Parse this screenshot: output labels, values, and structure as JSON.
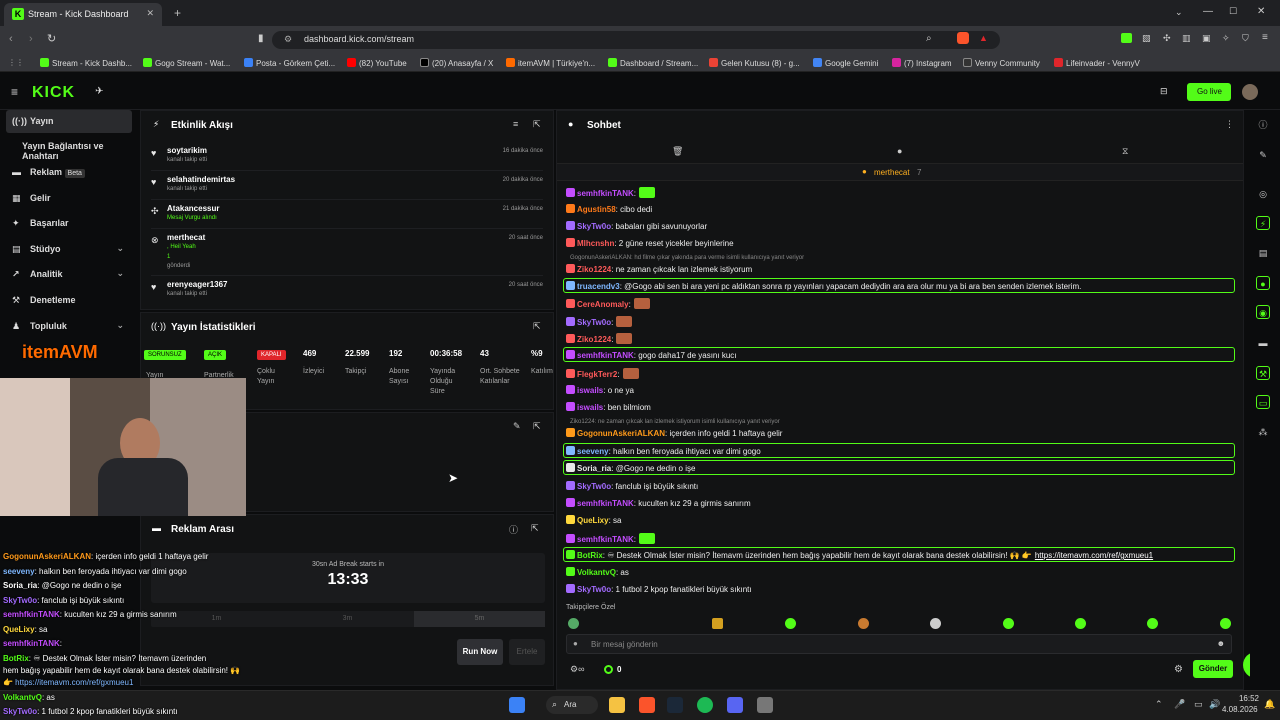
{
  "browser": {
    "tab_title": "Stream - Kick Dashboard",
    "url": "dashboard.kick.com/stream",
    "bookmarks": [
      "Stream - Kick Dashb...",
      "Gogo Stream - Wat...",
      "Posta - Görkem Çeti...",
      "(82) YouTube",
      "(20) Anasayfa / X",
      "itemAVM | Türkiye'n...",
      "Dashboard / Stream...",
      "Gelen Kutusu (8) - g...",
      "Google Gemini",
      "(7) Instagram",
      "Venny Community",
      "Lifeinvader - VennyV"
    ]
  },
  "nav": {
    "logo": "KICK",
    "go_live": "Go live"
  },
  "sidebar": {
    "items": [
      {
        "label": "Yayın"
      },
      {
        "label": "Yayın Bağlantısı ve Anahtarı"
      },
      {
        "label": "Reklam",
        "badge": "Beta"
      },
      {
        "label": "Gelir"
      },
      {
        "label": "Başarılar"
      },
      {
        "label": "Stüdyo"
      },
      {
        "label": "Analitik"
      },
      {
        "label": "Denetleme"
      },
      {
        "label": "Topluluk"
      }
    ]
  },
  "activity": {
    "title": "Etkinlik Akışı",
    "events": [
      {
        "name": "soytarikim",
        "sub": "kanalı takip etti",
        "time": "16 dakika önce"
      },
      {
        "name": "selahatindemirtas",
        "sub": "kanalı takip etti",
        "time": "20 dakika önce"
      },
      {
        "name": "Atakancessur",
        "sub": "Mesaj Vurgu alındı",
        "time": "21 dakika önce"
      },
      {
        "name": "merthecat",
        "sub": ", Heil Yeah",
        "sub2": "1",
        "sub3": "gönderdi",
        "time": "20 saat önce"
      },
      {
        "name": "erenyeager1367",
        "sub": "kanalı takip etti",
        "time": "20 saat önce"
      }
    ]
  },
  "stats": {
    "title": "Yayın İstatistikleri",
    "badges": [
      {
        "text": "SORUNSUZ",
        "color": "#53fc18"
      },
      {
        "text": "AÇIK",
        "color": "#53fc18"
      },
      {
        "text": "KAPALI",
        "color": "#e0262b"
      }
    ],
    "badge_labels": [
      "Yayın",
      "Partnerlik",
      "Çoklu Yayın"
    ],
    "values": [
      {
        "v": "469",
        "l": "İzleyici"
      },
      {
        "v": "22.599",
        "l": "Takipçi"
      },
      {
        "v": "192",
        "l": "Abone Sayısı"
      },
      {
        "v": "00:36:58",
        "l": "Yayında Olduğu Süre"
      },
      {
        "v": "43",
        "l": "Ort. Sohbete Katılanlar"
      },
      {
        "v": "%9",
        "l": "Katılım"
      }
    ]
  },
  "ad": {
    "title": "Reklam Arası",
    "note": "30sn Ad Break starts in",
    "countdown": "13:33",
    "options": [
      "1m",
      "3m",
      "5m"
    ],
    "run": "Run Now",
    "delay": "Ertele"
  },
  "overlay_logo": "itemAVM",
  "chat": {
    "title": "Sohbet",
    "pinned_user": "merthecat",
    "pinned_count": "7",
    "lines": [
      {
        "user": "semhfkinTANK",
        "color": "#c44dff",
        "text": ":",
        "emote": true
      },
      {
        "user": "Agustin58",
        "color": "#ff7a1a",
        "text": ": cibo dedi"
      },
      {
        "user": "SkyTw0o",
        "color": "#a36bff",
        "text": ": babaları gibi savunuyorlar"
      },
      {
        "user": "Mlhcnshn",
        "color": "#ff5a5a",
        "text": ": 2 güne reset yicekler beyinlerine"
      },
      {
        "reply": "GogonunAskeriALKAN: hd filme çıkar yakında para verme isimli kullanıcıya yanıt veriyor"
      },
      {
        "user": "Ziko1224",
        "color": "#ff5a5a",
        "text": ": ne zaman çıkcak lan izlemek istiyorum"
      },
      {
        "user": "truacendv3",
        "color": "#7fb8ff",
        "text": ": @Gogo abi sen bi ara yeni pc aldıktan sonra rp yayınları yapacam dediydin ara ara olur mu ya bi ara ben senden izlemek isterim.",
        "hl": true
      },
      {
        "user": "CereAnomaly",
        "color": "#ff5a5a",
        "text": ":",
        "emote": true
      },
      {
        "user": "SkyTw0o",
        "color": "#a36bff",
        "text": ":",
        "emote": true
      },
      {
        "user": "Ziko1224",
        "color": "#ff5a5a",
        "text": ":",
        "emote": true
      },
      {
        "user": "semhfkinTANK",
        "color": "#c44dff",
        "text": ": gogo daha17 de yasını kucı",
        "hl": true
      },
      {
        "user": "FlegkTerr2",
        "color": "#ff5a5a",
        "text": ":",
        "emote": true
      },
      {
        "user": "iswails",
        "color": "#c44dff",
        "text": ": o ne ya"
      },
      {
        "user": "iswails",
        "color": "#c44dff",
        "text": ": ben bilmiom"
      },
      {
        "reply": "Ziko1224: ne zaman çıkcak lan izlemek istiyorum isimli kullanıcıya yanıt veriyor"
      },
      {
        "user": "GogonunAskeriALKAN",
        "color": "#ff9a1a",
        "text": ": içerden info geldi 1 haftaya gelir"
      },
      {
        "user": "seeveny",
        "color": "#7fb8ff",
        "text": ": halkın ben feroyada ihtiyacı var dimi gogo",
        "hl": true
      },
      {
        "user": "Soria_ria",
        "color": "#e8e8e8",
        "text": ": @Gogo ne dedin o işe",
        "hl": true
      },
      {
        "user": "SkyTw0o",
        "color": "#a36bff",
        "text": ": fanclub işi büyük sıkıntı"
      },
      {
        "user": "semhfkinTANK",
        "color": "#c44dff",
        "text": ": kuculten kız 29 a girmis sanırım"
      },
      {
        "user": "QueLixy",
        "color": "#ffd93d",
        "text": ": sa"
      },
      {
        "user": "semhfkinTANK",
        "color": "#c44dff",
        "text": ":",
        "emote": true
      },
      {
        "user": "BotRix",
        "color": "#53fc18",
        "text": ": ♾ Destek Olmak İster misin? İtemavm üzerinden hem bağış yapabilir hem de kayıt olarak bana destek olabilirsin! 🙌 👉",
        "link": "https://itemavm.com/ref/gxmueu1",
        "hl": true
      },
      {
        "user": "VolkantvQ",
        "color": "#53fc18",
        "text": ": as"
      },
      {
        "user": "SkyTw0o",
        "color": "#a36bff",
        "text": ": 1 futbol 2 kpop fanatikleri büyük sıkıntı"
      }
    ],
    "follower_only": "Takipçilere Özel",
    "input_placeholder": "Bir mesaj gönderin",
    "points": "0",
    "send": "Gönder"
  },
  "overlay_chat": [
    {
      "user": "GogonunAskeriALKAN",
      "color": "#ff9a1a",
      "text": ": içerden info geldi 1 haftaya gelir"
    },
    {
      "user": "seeveny",
      "color": "#7fb8ff",
      "text": ": halkın ben feroyada ihtiyacı var dimi gogo"
    },
    {
      "user": "Soria_ria",
      "color": "#e8e8e8",
      "text": ": @Gogo ne dedin o işe"
    },
    {
      "user": "SkyTw0o",
      "color": "#a36bff",
      "text": ": fanclub işi büyük sıkıntı"
    },
    {
      "user": "semhfkinTANK",
      "color": "#c44dff",
      "text": ": kuculten kız 29 a girmis sanırım"
    },
    {
      "user": "QueLixy",
      "color": "#ffd93d",
      "text": ": sa"
    },
    {
      "user": "semhfkinTANK",
      "color": "#c44dff",
      "text": ":"
    },
    {
      "user": "BotRix",
      "color": "#53fc18",
      "text": ": ♾ Destek Olmak İster misin? İtemavm üzerinden"
    },
    {
      "user": "",
      "color": "#fff",
      "text": "hem bağış yapabilir hem de kayıt olarak bana destek olabilirsin! 🙌"
    },
    {
      "user": "",
      "color": "#7fb8ff",
      "text": "👉 https://itemavm.com/ref/gxmueu1"
    },
    {
      "user": "VolkantvQ",
      "color": "#53fc18",
      "text": ": as"
    },
    {
      "user": "SkyTw0o",
      "color": "#a36bff",
      "text": ": 1 futbol 2 kpop fanatikleri büyük sıkıntı"
    }
  ],
  "taskbar": {
    "search": "Ara",
    "time": "16:52",
    "date": "4.08.2026"
  }
}
